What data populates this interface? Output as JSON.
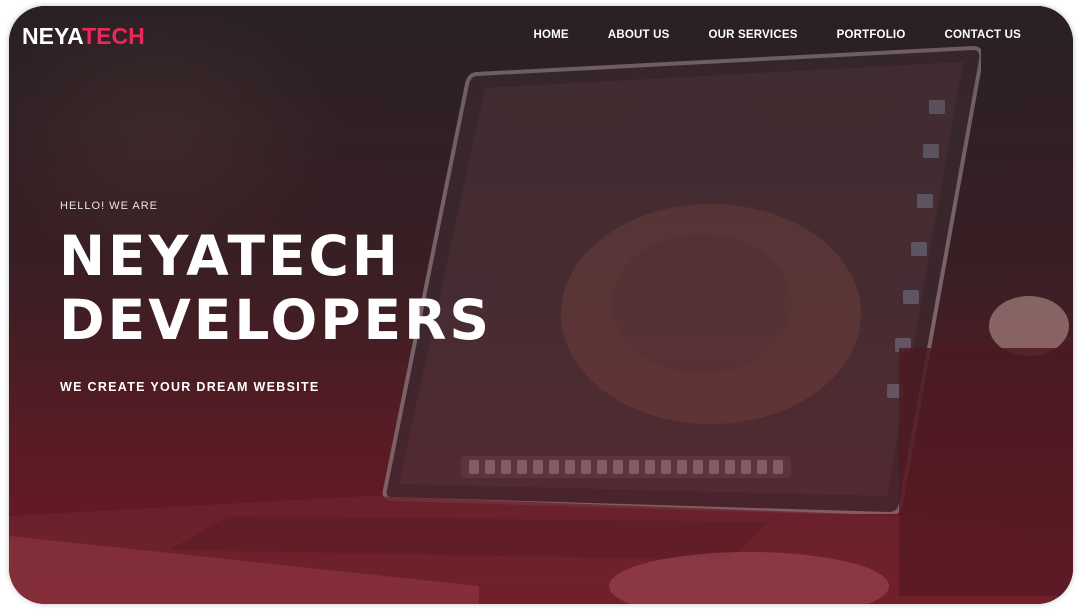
{
  "brand": {
    "logo_part1": "NEYA",
    "logo_part2": "TECH",
    "accent_color": "#e8295a"
  },
  "nav": {
    "items": [
      {
        "label": "HOME"
      },
      {
        "label": "ABOUT US"
      },
      {
        "label": "OUR SERVICES"
      },
      {
        "label": "PORTFOLIO"
      },
      {
        "label": "CONTACT US"
      }
    ]
  },
  "hero": {
    "greeting": "HELLO! WE ARE",
    "headline_line1": "NEYATECH",
    "headline_line2": "DEVELOPERS",
    "tagline": "WE CREATE YOUR DREAM WEBSITE",
    "background_subject": "laptop-on-desk-photo",
    "overlay_color": "#6a1a22"
  }
}
